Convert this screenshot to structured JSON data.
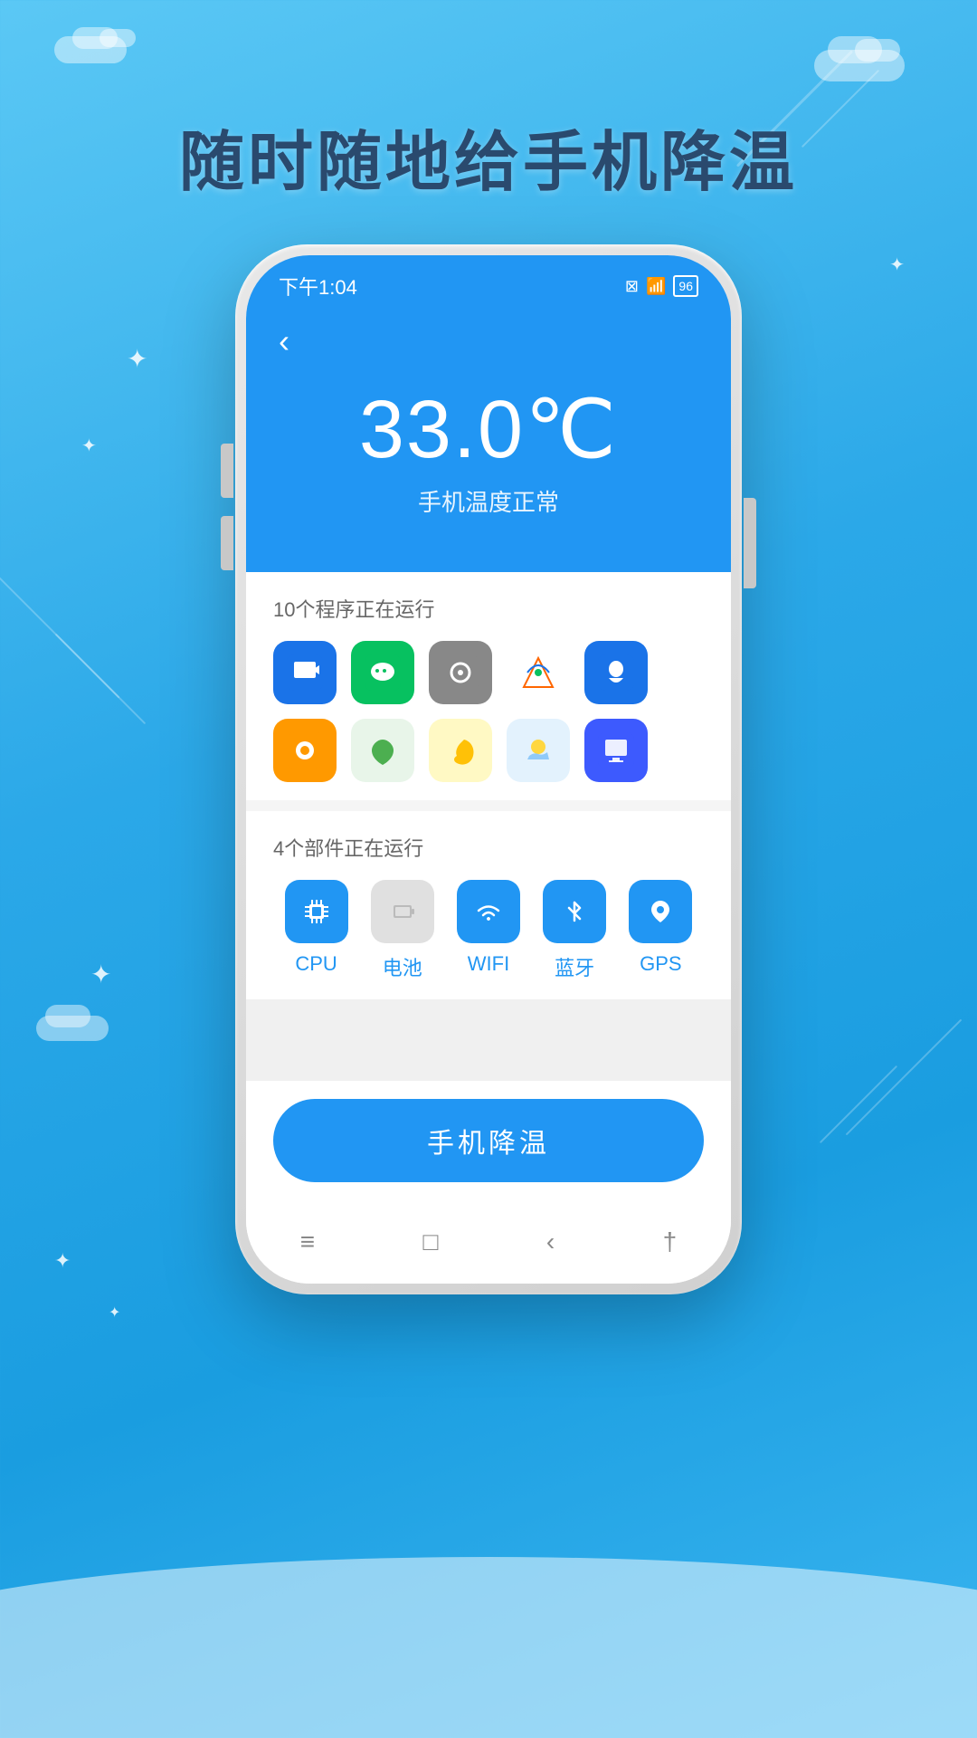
{
  "background": {
    "gradient_start": "#5bc8f5",
    "gradient_end": "#1a9de0"
  },
  "page_title": "随时随地给手机降温",
  "status_bar": {
    "time": "下午1:04",
    "battery": "96"
  },
  "app": {
    "back_button": "‹",
    "temperature": {
      "value": "33.0℃",
      "status": "手机温度正常"
    },
    "running_apps_section": {
      "title": "10个程序正在运行",
      "apps": [
        {
          "id": 1,
          "icon": "📹",
          "color": "#1a73e8"
        },
        {
          "id": 2,
          "icon": "💬",
          "color": "#07c160"
        },
        {
          "id": 3,
          "icon": "🔊",
          "color": "#888"
        },
        {
          "id": 4,
          "icon": "🎨",
          "color": "#f60"
        },
        {
          "id": 5,
          "icon": "🐧",
          "color": "#1a73e8"
        },
        {
          "id": 6,
          "icon": "🎵",
          "color": "#f90"
        },
        {
          "id": 7,
          "icon": "🌿",
          "color": "#e8f5e9"
        },
        {
          "id": 8,
          "icon": "🍋",
          "color": "#fff3e0"
        },
        {
          "id": 9,
          "icon": "🌤",
          "color": "#e3f2fd"
        },
        {
          "id": 10,
          "icon": "🖥",
          "color": "#3d5afe"
        }
      ]
    },
    "components_section": {
      "title": "4个部件正在运行",
      "components": [
        {
          "id": "cpu",
          "label": "CPU",
          "icon": "⊞",
          "style": "comp-cpu"
        },
        {
          "id": "battery",
          "label": "电池",
          "icon": "▯",
          "style": "comp-battery"
        },
        {
          "id": "wifi",
          "label": "WIFI",
          "icon": "((·))",
          "style": "comp-wifi"
        },
        {
          "id": "bluetooth",
          "label": "蓝牙",
          "icon": "✱",
          "style": "comp-bt"
        },
        {
          "id": "gps",
          "label": "GPS",
          "icon": "◎",
          "style": "comp-gps"
        }
      ]
    },
    "cool_button_label": "手机降温",
    "nav_items": [
      {
        "id": "menu",
        "icon": "≡"
      },
      {
        "id": "home",
        "icon": "□"
      },
      {
        "id": "back",
        "icon": "‹"
      },
      {
        "id": "recent",
        "icon": "†"
      }
    ]
  }
}
